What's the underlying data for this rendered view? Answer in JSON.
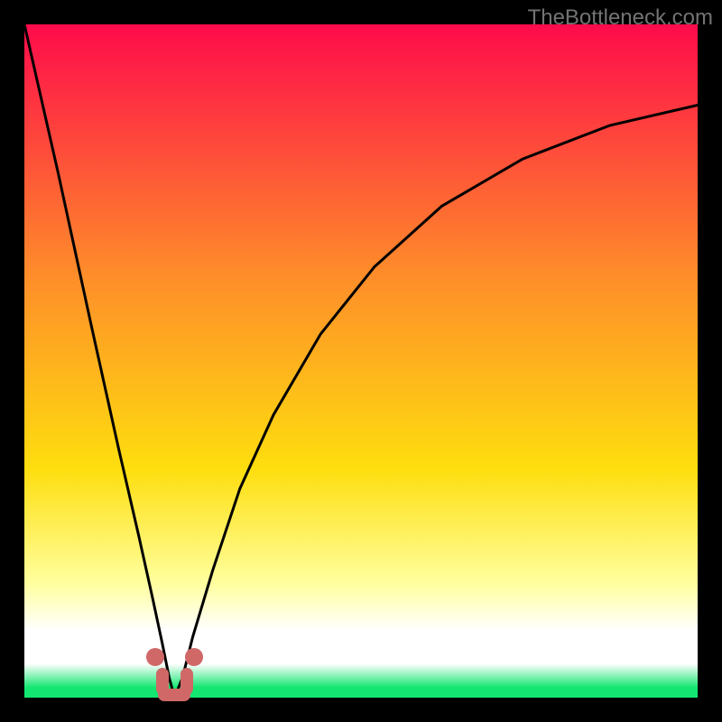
{
  "watermark": "TheBottleneck.com",
  "colors": {
    "top": "#fe0b4b",
    "mid1": "#fe8c2a",
    "mid2": "#fede0e",
    "pale": "#ffff9e",
    "white": "#ffffff",
    "green": "#13e771",
    "curve": "#000000",
    "marker": "#cf6867"
  },
  "axis_fraction": {
    "x_min": 0,
    "x_max": 1,
    "y_min": 0,
    "y_max": 1
  },
  "dip_x": 0.223,
  "chart_data": {
    "type": "line",
    "title": "",
    "xlabel": "",
    "ylabel": "",
    "xlim": [
      0,
      1
    ],
    "ylim": [
      0,
      1
    ],
    "series": [
      {
        "name": "bottleneck-curve",
        "x": [
          0.0,
          0.05,
          0.1,
          0.14,
          0.17,
          0.19,
          0.205,
          0.215,
          0.223,
          0.235,
          0.25,
          0.28,
          0.32,
          0.37,
          0.44,
          0.52,
          0.62,
          0.74,
          0.87,
          1.0
        ],
        "y": [
          1.0,
          0.78,
          0.55,
          0.37,
          0.24,
          0.15,
          0.08,
          0.03,
          0.0,
          0.03,
          0.09,
          0.19,
          0.31,
          0.42,
          0.54,
          0.64,
          0.73,
          0.8,
          0.85,
          0.88
        ]
      }
    ],
    "markers": [
      {
        "name": "dip-left-dot",
        "x": 0.195,
        "y": 0.06
      },
      {
        "name": "dip-right-dot",
        "x": 0.252,
        "y": 0.06
      },
      {
        "name": "dip-left-seg",
        "x": 0.205,
        "y": 0.024
      },
      {
        "name": "dip-right-seg",
        "x": 0.241,
        "y": 0.024
      },
      {
        "name": "dip-bottom-seg",
        "x": 0.223,
        "y": 0.004,
        "horizontal": true
      }
    ]
  }
}
